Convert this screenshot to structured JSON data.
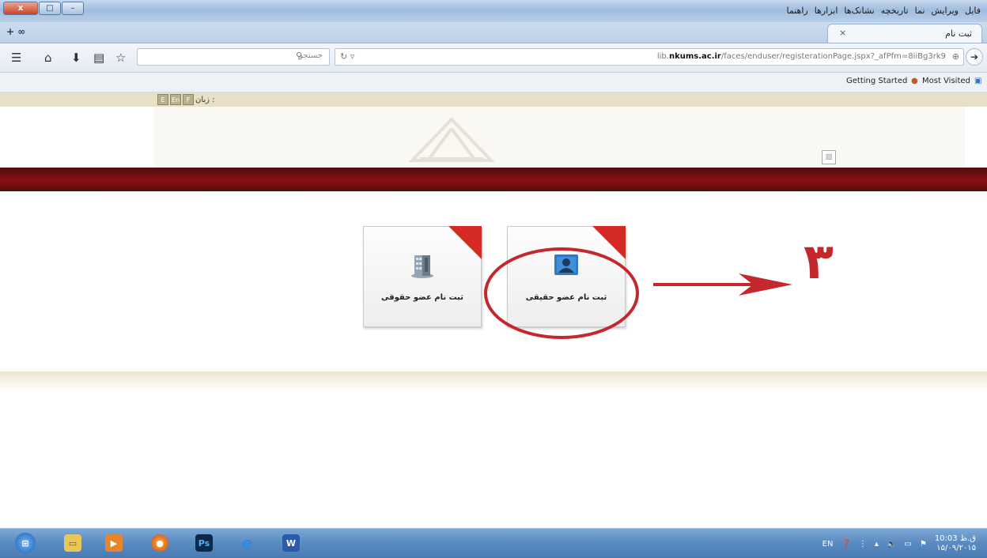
{
  "window": {
    "menu": [
      "فایل",
      "ویرایش",
      "نما",
      "تاریخچه",
      "نشانک‌ها",
      "ابزارها",
      "راهنما"
    ],
    "controls": {
      "minimize": "–",
      "maximize": "□",
      "close": "x"
    }
  },
  "tabs": {
    "new_tab": "+ ∞",
    "active_title": "ثبت نام",
    "close_glyph": "×"
  },
  "toolbar": {
    "search_placeholder": "جستجو",
    "url_prefix": "lib.",
    "url_host": "nkums.ac.ir",
    "url_path": "/faces/enduser/registerationPage.jspx?_afPfm=8iiBg3rk9"
  },
  "bookmarks": {
    "items": [
      "Getting Started",
      "Most Visited"
    ]
  },
  "page": {
    "language_label": "زبان :",
    "flags": [
      "E",
      "En",
      "F"
    ],
    "options": [
      {
        "label": "ثبت نام عضو حقوقی",
        "icon": "building-icon"
      },
      {
        "label": "ثبت نام عضو حقیقی",
        "icon": "person-icon"
      }
    ],
    "step_number": "۳"
  },
  "taskbar": {
    "apps": [
      "start-orb",
      "explorer",
      "media-player",
      "firefox",
      "photoshop",
      "internet-explorer",
      "word"
    ],
    "lang": "EN",
    "time": "10:03 ق.ظ",
    "date": "۱۵/۰۹/۲۰۱۵"
  },
  "colors": {
    "accent_red": "#c4272d",
    "banner_red": "#8a1115",
    "taskbar_blue": "#5b8cc2"
  }
}
